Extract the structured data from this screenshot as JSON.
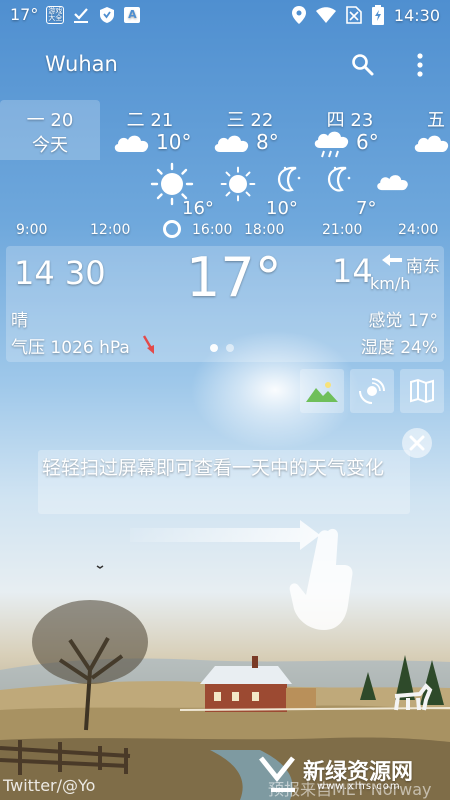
{
  "status_bar": {
    "temp": "17°",
    "app_icon_text": "游戏大全",
    "app_letter": "A",
    "time": "14:30"
  },
  "app_bar": {
    "city": "Wuhan"
  },
  "days": [
    {
      "name": "一 20",
      "sub": "今天",
      "selected": true
    },
    {
      "name": "二 21",
      "temp": "10°",
      "icon": "cloud-icon"
    },
    {
      "name": "三 22",
      "temp": "8°",
      "icon": "cloud-icon"
    },
    {
      "name": "四 23",
      "temp": "6°",
      "icon": "rain-cloud-icon"
    },
    {
      "name": "五",
      "icon": "cloud-icon"
    }
  ],
  "hourly": {
    "temps": [
      "16°",
      "10°",
      "7°"
    ],
    "times": [
      "9:00",
      "12:00",
      "16:00",
      "18:00",
      "21:00",
      "24:00"
    ]
  },
  "current": {
    "time_hh": "14",
    "time_mm": "30",
    "temp": "17°",
    "wind_speed": "14",
    "wind_unit": "km/h",
    "wind_dir": "南东",
    "condition": "晴",
    "feels_like": "感觉 17°",
    "pressure": "气压 1026 hPa",
    "humidity": "湿度 24%"
  },
  "hint": {
    "text": "轻轻扫过屏幕即可查看一天中的天气变化"
  },
  "footer": {
    "left": "Twitter/@Yo",
    "right": "预报来自MET Norway",
    "watermark": "新绿资源网",
    "watermark_sub": "www.xlhs.com"
  },
  "colors": {
    "sky_top": "#4f8fd0",
    "pressure_arrow": "#e34a4a"
  }
}
